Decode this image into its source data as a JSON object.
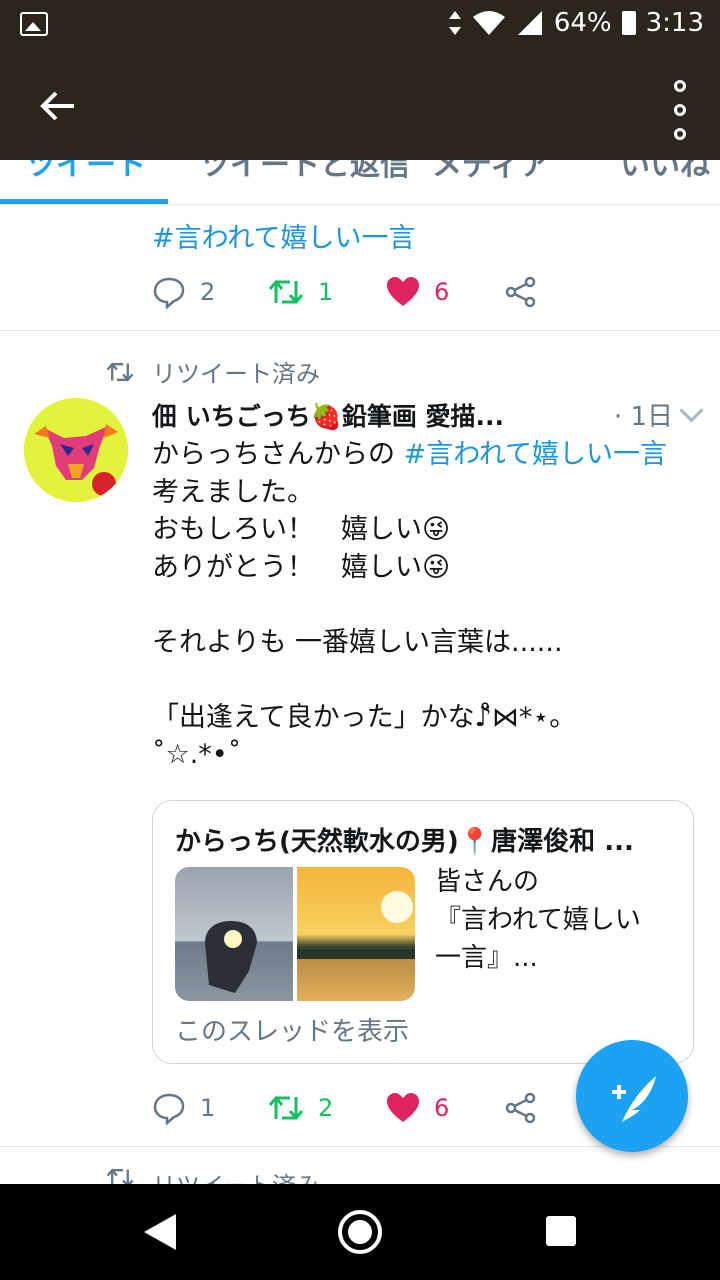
{
  "status": {
    "battery": "64%",
    "time": "3:13"
  },
  "tabs": [
    "ツイート",
    "ツイートと返信",
    "メディア",
    "いいね"
  ],
  "first_tweet": {
    "tail_hashtag": "#言われて嬉しい一言",
    "counts": {
      "replies": "2",
      "retweets": "1",
      "likes": "6"
    }
  },
  "tweet": {
    "retweet_label": "リツイート済み",
    "author": "佃 いちごっち🍓鉛筆画 愛描...",
    "time": "· 1日",
    "text_intro": "からっちさんからの ",
    "hashtag": "#言われて嬉しい一言",
    "text_body": "　考えました。\nおもしろい！　嬉しい😜\nありがとう！　嬉しい😜\n\nそれよりも 一番嬉しい言葉は......\n\n「出逢えて良かった」かな♪̊̈⋈*⋆。\n˚☆.*•˚",
    "counts": {
      "replies": "1",
      "retweets": "2",
      "likes": "6"
    }
  },
  "quoted": {
    "author": "からっち(天然軟水の男)📍唐澤俊和 ...",
    "text": "皆さんの\n『言われて嬉しい\n一言』...",
    "show_thread": "このスレッドを表示"
  },
  "next_retweet_label": "リツイート済み",
  "colors": {
    "accent": "#1da1f2",
    "like": "#e0245e",
    "retweet": "#17bf63",
    "appbar": "#2c251d"
  }
}
